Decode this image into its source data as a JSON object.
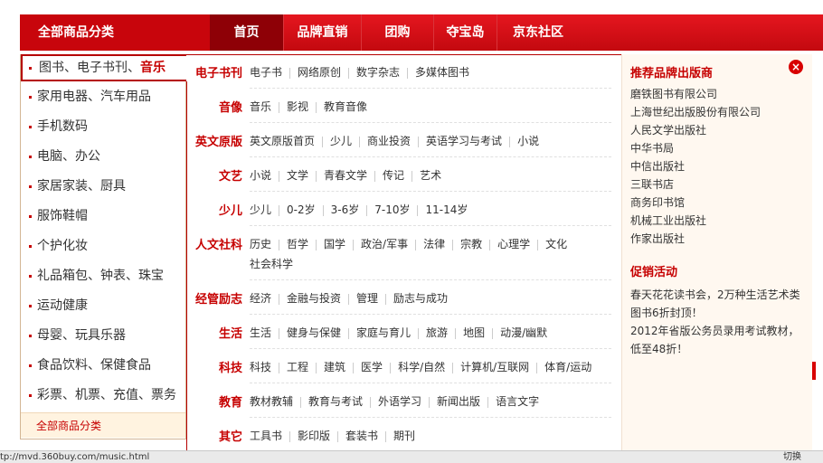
{
  "nav": {
    "all_categories": "全部商品分类",
    "tabs": [
      {
        "label": "首页"
      },
      {
        "label": "品牌直销"
      },
      {
        "label": "团购"
      },
      {
        "label": "夺宝岛"
      },
      {
        "label": "京东社区"
      }
    ]
  },
  "left_menu": {
    "active_prefix": "图书、电子书刊、",
    "active_highlight": "音乐",
    "items": [
      {
        "label": "家用电器、汽车用品"
      },
      {
        "label": "手机数码"
      },
      {
        "label": "电脑、办公"
      },
      {
        "label": "家居家装、厨具"
      },
      {
        "label": "服饰鞋帽"
      },
      {
        "label": "个护化妆"
      },
      {
        "label": "礼品箱包、钟表、珠宝"
      },
      {
        "label": "运动健康"
      },
      {
        "label": "母婴、玩具乐器"
      },
      {
        "label": "食品饮料、保健食品"
      },
      {
        "label": "彩票、机票、充值、票务"
      }
    ],
    "all_label": "全部商品分类"
  },
  "subcats": [
    {
      "label": "电子书刊",
      "links": [
        "电子书",
        "网络原创",
        "数字杂志",
        "多媒体图书"
      ]
    },
    {
      "label": "音像",
      "links": [
        "音乐",
        "影视",
        "教育音像"
      ]
    },
    {
      "label": "英文原版",
      "links": [
        "英文原版首页",
        "少儿",
        "商业投资",
        "英语学习与考试",
        "小说"
      ]
    },
    {
      "label": "文艺",
      "links": [
        "小说",
        "文学",
        "青春文学",
        "传记",
        "艺术"
      ]
    },
    {
      "label": "少儿",
      "links": [
        "少儿",
        "0-2岁",
        "3-6岁",
        "7-10岁",
        "11-14岁"
      ]
    },
    {
      "label": "人文社科",
      "links": [
        "历史",
        "哲学",
        "国学",
        "政治/军事",
        "法律",
        "宗教",
        "心理学",
        "文化",
        "社会科学"
      ]
    },
    {
      "label": "经管励志",
      "links": [
        "经济",
        "金融与投资",
        "管理",
        "励志与成功"
      ]
    },
    {
      "label": "生活",
      "links": [
        "生活",
        "健身与保健",
        "家庭与育儿",
        "旅游",
        "地图",
        "动漫/幽默"
      ]
    },
    {
      "label": "科技",
      "links": [
        "科技",
        "工程",
        "建筑",
        "医学",
        "科学/自然",
        "计算机/互联网",
        "体育/运动"
      ]
    },
    {
      "label": "教育",
      "links": [
        "教材教辅",
        "教育与考试",
        "外语学习",
        "新闻出版",
        "语言文字"
      ]
    },
    {
      "label": "其它",
      "links": [
        "工具书",
        "影印版",
        "套装书",
        "期刊"
      ]
    }
  ],
  "side": {
    "brands_title": "推荐品牌出版商",
    "publishers": [
      "磨铁图书有限公司",
      "上海世纪出版股份有限公司",
      "人民文学出版社",
      "中华书局",
      "中信出版社",
      "三联书店",
      "商务印书馆",
      "机械工业出版社",
      "作家出版社"
    ],
    "promo_title": "促销活动",
    "promos": [
      "春天花花读书会，2万种生活艺术类图书6折封顶！",
      "2012年省版公务员录用考试教材，低至48折！"
    ]
  },
  "close_icon": "×",
  "status": {
    "url": "tp://mvd.360buy.com/music.html",
    "right_text": "切换"
  },
  "colors": {
    "accent": "#c60000",
    "nav_red": "#d80c14",
    "nav_active": "#8e0006"
  }
}
